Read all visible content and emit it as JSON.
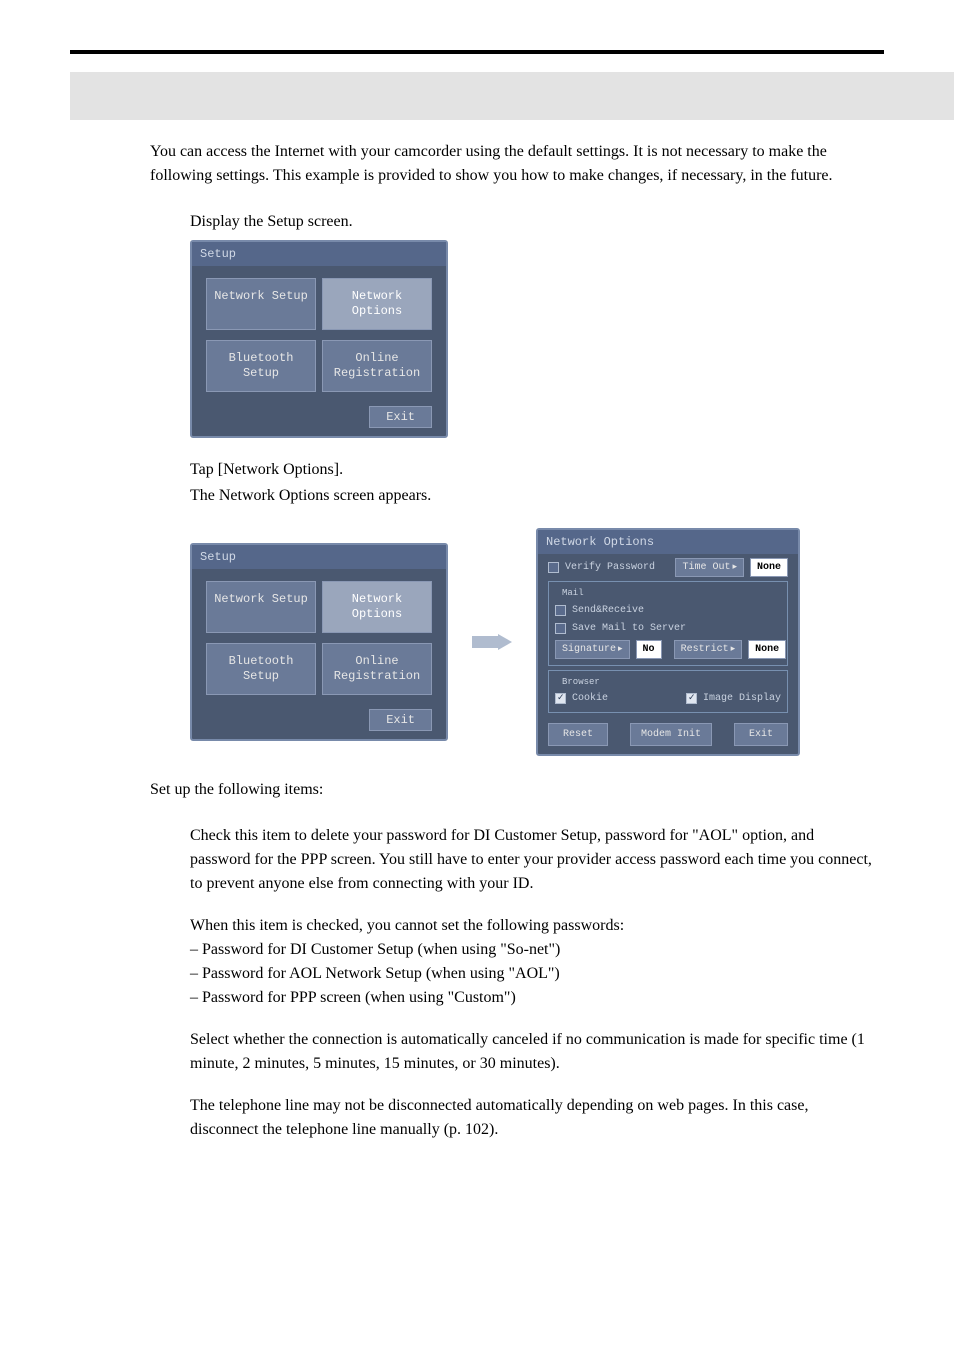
{
  "intro": "You can access the Internet with your camcorder using the default settings. It is not necessary to make the following settings. This example is provided to show you how to make changes, if necessary, in the future.",
  "step1": "Display the Setup screen.",
  "step2_line1": "Tap [Network Options].",
  "step2_line2": "The Network Options screen appears.",
  "set_following": "Set up the following items:",
  "verify_desc": " Check this item to delete your password for DI Customer Setup, password for \"AOL\" option, and password for the PPP screen. You still have to enter your provider access password each time you connect, to prevent anyone else from connecting with your ID.",
  "verify_note": "When this item is checked, you cannot set the following passwords:",
  "bullet1": "– Password for DI Customer Setup (when using \"So-net\")",
  "bullet2": "– Password for AOL Network Setup (when using \"AOL\")",
  "bullet3": "– Password for PPP screen (when using \"Custom\")",
  "timeout_desc": " Select whether the connection is automatically canceled if no communication is made for specific time (1 minute, 2 minutes, 5 minutes, 15 minutes, or 30 minutes).",
  "disconnect_note": "The telephone line may not be disconnected automatically depending on web pages. In this case, disconnect the telephone line manually (p. 102).",
  "setup_win": {
    "title": "Setup",
    "network_setup": "Network Setup",
    "network_options": "Network Options",
    "bluetooth_setup": "Bluetooth Setup",
    "online_reg": "Online\nRegistration",
    "exit": "Exit"
  },
  "netopts": {
    "title": "Network Options",
    "verify_password": "Verify Password",
    "time_out": "Time Out",
    "time_out_val": "None",
    "mail": "Mail",
    "send_receive": "Send&Receive",
    "save_mail": "Save Mail to Server",
    "signature": "Signature",
    "signature_val": "No",
    "restrict": "Restrict",
    "restrict_val": "None",
    "browser": "Browser",
    "cookie": "Cookie",
    "image_display": "Image Display",
    "reset": "Reset",
    "modem_init": "Modem Init",
    "exit": "Exit"
  }
}
